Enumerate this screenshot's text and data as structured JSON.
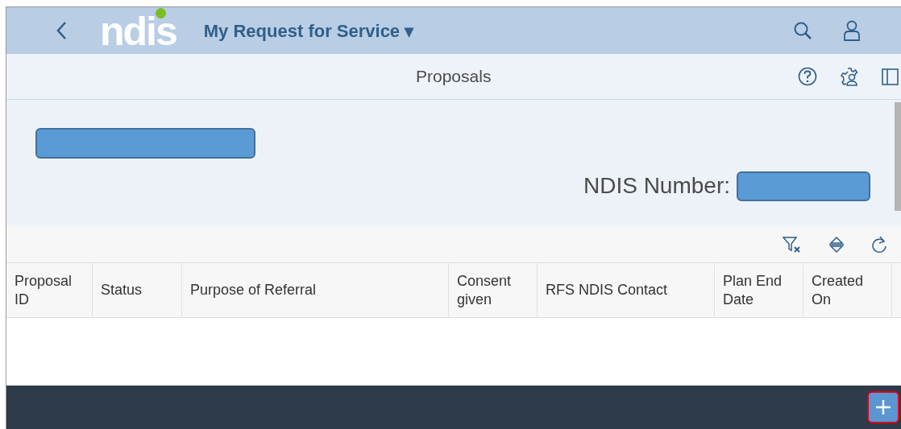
{
  "shell": {
    "logo": "ndis",
    "app_title": "My Request for Service ▾"
  },
  "page": {
    "title": "Proposals"
  },
  "object_header": {
    "ndis_number_label": "NDIS Number:"
  },
  "table": {
    "columns": [
      {
        "label": "Proposal ID"
      },
      {
        "label": "Status"
      },
      {
        "label": "Purpose of Referral"
      },
      {
        "label": "Consent given"
      },
      {
        "label": "RFS NDIS Contact"
      },
      {
        "label": "Plan End Date"
      },
      {
        "label": "Created On"
      }
    ]
  }
}
